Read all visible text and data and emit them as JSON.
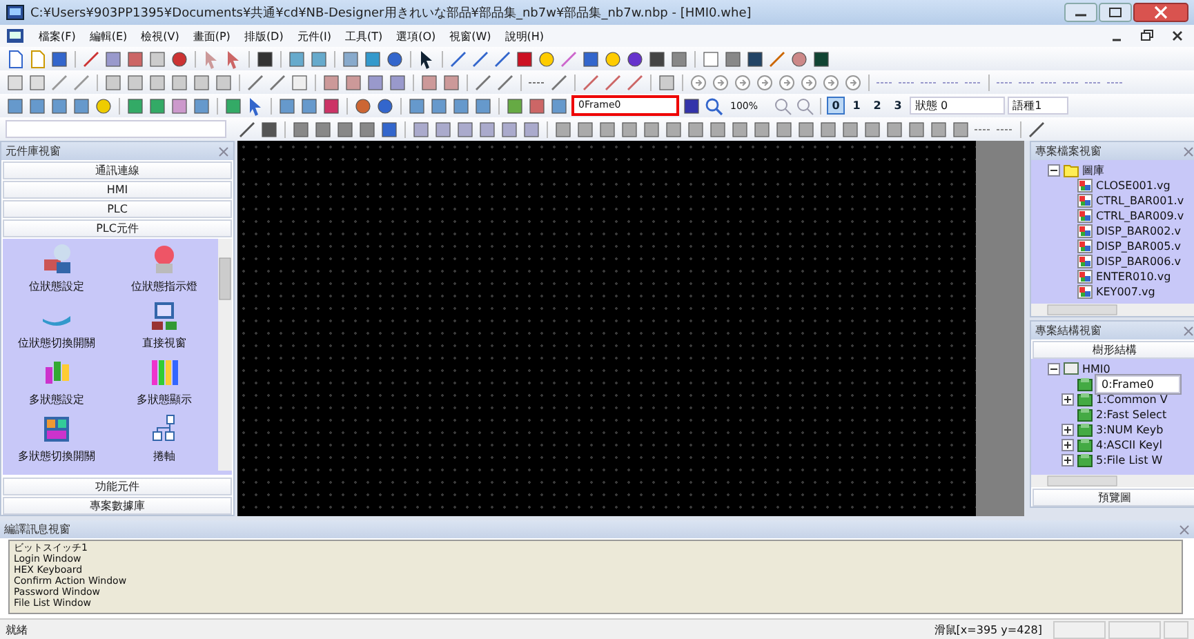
{
  "window": {
    "title": "C:¥Users¥903PP1395¥Documents¥共通¥cd¥NB-Designer用きれいな部品¥部品集_nb7w¥部品集_nb7w.nbp - [HMI0.whe]"
  },
  "menu_bar": {
    "items": [
      "檔案(F)",
      "編輯(E)",
      "檢視(V)",
      "畫面(P)",
      "排版(D)",
      "元件(I)",
      "工具(T)",
      "選項(O)",
      "視窗(W)",
      "說明(H)"
    ]
  },
  "toolbar": {
    "frame_field": "0Frame0",
    "zoom": "100%",
    "state_buttons": [
      {
        "label": "0",
        "selected": true
      },
      {
        "label": "1",
        "selected": false
      },
      {
        "label": "2",
        "selected": false
      },
      {
        "label": "3",
        "selected": false
      }
    ],
    "state_select": "狀態 0",
    "language_select": "語種1"
  },
  "component_panel": {
    "title": "元件庫視窗",
    "categories_top": [
      "通訊連線",
      "HMI",
      "PLC",
      "PLC元件"
    ],
    "items": [
      {
        "label": "位狀態設定"
      },
      {
        "label": "位狀態指示燈"
      },
      {
        "label": "位狀態切換開關"
      },
      {
        "label": "直接視窗"
      },
      {
        "label": "多狀態設定"
      },
      {
        "label": "多狀態顯示"
      },
      {
        "label": "多狀態切換開關"
      },
      {
        "label": "捲軸"
      }
    ],
    "categories_bottom": [
      "功能元件",
      "專案數據庫"
    ]
  },
  "project_files": {
    "title": "專案檔案視窗",
    "tree": {
      "label": "圖庫",
      "expanded": true,
      "children": [
        {
          "label": "CLOSE001.vg"
        },
        {
          "label": "CTRL_BAR001.v"
        },
        {
          "label": "CTRL_BAR009.v"
        },
        {
          "label": "DISP_BAR002.v"
        },
        {
          "label": "DISP_BAR005.v"
        },
        {
          "label": "DISP_BAR006.v"
        },
        {
          "label": "ENTER010.vg"
        },
        {
          "label": "KEY007.vg"
        }
      ]
    }
  },
  "project_structure": {
    "title": "專案結構視窗",
    "tab": "樹形結構",
    "tree": {
      "label": "HMI0",
      "expanded": true,
      "selected": false,
      "children": [
        {
          "label": "0:Frame0",
          "selected": true
        },
        {
          "label": "1:Common V",
          "expanded": false,
          "selected": false
        },
        {
          "label": "2:Fast Select",
          "selected": false
        },
        {
          "label": "3:NUM Keyb",
          "expanded": false,
          "selected": false
        },
        {
          "label": "4:ASCII Keyl",
          "expanded": false,
          "selected": false
        },
        {
          "label": "5:File List W",
          "expanded": false,
          "selected": false
        }
      ]
    },
    "footer": "預覽圖"
  },
  "output_panel": {
    "title": "編譯訊息視窗",
    "lines": [
      "ビットスイッチ1",
      "Login Window",
      "HEX Keyboard",
      "Confirm Action Window",
      "Password Window",
      "File List Window"
    ]
  },
  "status_bar": {
    "status": "就緒",
    "mouse": "滑鼠[x=395 y=428]"
  }
}
